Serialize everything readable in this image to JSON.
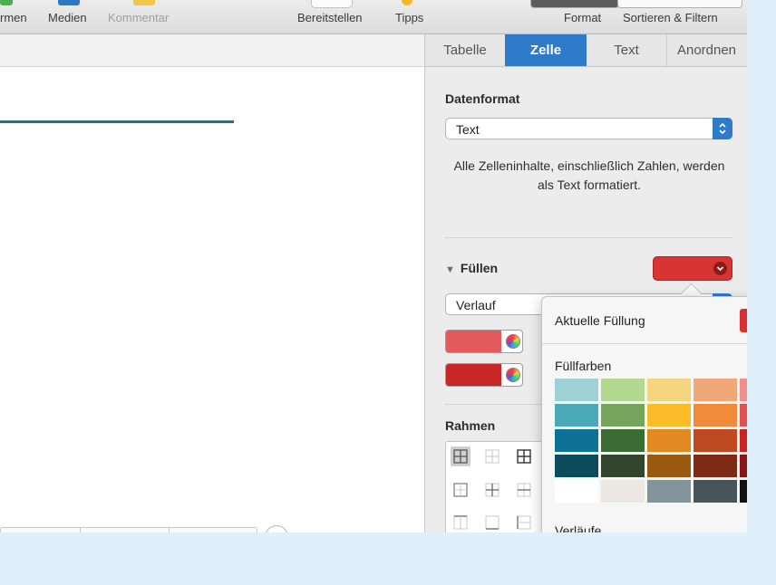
{
  "toolbar": {
    "left_labels": [
      "rmen",
      "Medien",
      "Kommentar"
    ],
    "right_labels": [
      "Bereitstellen",
      "Tipps"
    ],
    "format_label": "Format",
    "sort_label": "Sortieren & Filtern"
  },
  "inspector": {
    "tabs": [
      "Tabelle",
      "Zelle",
      "Text",
      "Anordnen"
    ],
    "active_tab": "Zelle",
    "data_format": {
      "title": "Datenformat",
      "value": "Text",
      "description": "Alle Zelleninhalte, einschließlich Zahlen, werden als Text formatiert."
    },
    "fill": {
      "title": "Füllen",
      "type_value": "Verlauf",
      "well_color": "#d93434",
      "gradient_colors": [
        "#e35b5b",
        "#c82727"
      ]
    },
    "border": {
      "title": "Rahmen"
    }
  },
  "color_popover": {
    "current_fill_label": "Aktuelle Füllung",
    "current_fill_color": "#d73030",
    "fill_colors_label": "Füllfarben",
    "gradients_label": "Verläufe",
    "palette": [
      [
        "#9fd0d4",
        "#b3d890",
        "#f5d47e",
        "#f0a878",
        "#ef8f8f"
      ],
      [
        "#4aa9b6",
        "#75a55c",
        "#fcbc2a",
        "#f28a3c",
        "#e05252"
      ],
      [
        "#0e7296",
        "#3a6c34",
        "#e28a21",
        "#bf4a22",
        "#c82424"
      ],
      [
        "#0c4a5e",
        "#33452e",
        "#9a5a0f",
        "#7f2a14",
        "#8a1515"
      ],
      [
        "#ffffff",
        "#ebe8e3",
        "#84949b",
        "#47555a",
        "#111111"
      ]
    ]
  }
}
